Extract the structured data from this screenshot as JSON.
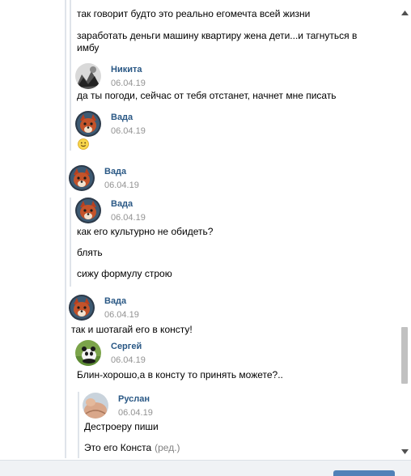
{
  "messages": {
    "m1": "так говорит будто это реально егомечта всей жизни",
    "m2": "заработать деньги машину квартиру жена дети...и тагнуться в имбу",
    "m3": "да ты погоди, сейчас от тебя отстанет, начнет мне писать",
    "m4": "как его культурно не обидеть?",
    "m5": "блять",
    "m6": "сижу формулу строю",
    "m7": "так и шотагай его в консту!",
    "m8": "Блин-хорошо,а в консту то принять можете?..",
    "m9": "Дестроеру пиши",
    "m10": "Это его Конста",
    "edited_label": "(ред.)"
  },
  "authors": {
    "a1": {
      "name": "Никита",
      "date": "06.04.19"
    },
    "a2": {
      "name": "Вада",
      "date": "06.04.19"
    },
    "a3": {
      "name": "Вада",
      "date": "06.04.19"
    },
    "a4": {
      "name": "Вада",
      "date": "06.04.19"
    },
    "a5": {
      "name": "Вада",
      "date": "06.04.19"
    },
    "a6": {
      "name": "Сергей",
      "date": "06.04.19"
    },
    "a7": {
      "name": "Руслан",
      "date": "06.04.19"
    }
  },
  "icons": {
    "emoji": "slightly-smiling-face-icon",
    "scroll_up": "triangle-up-icon",
    "scroll_down": "triangle-down-icon"
  },
  "colors": {
    "author_name": "#2a5885",
    "date": "#939393",
    "quote_line": "#dfe4ea",
    "scroll_thumb": "#c1c1c1",
    "send_button": "#5181b8"
  }
}
